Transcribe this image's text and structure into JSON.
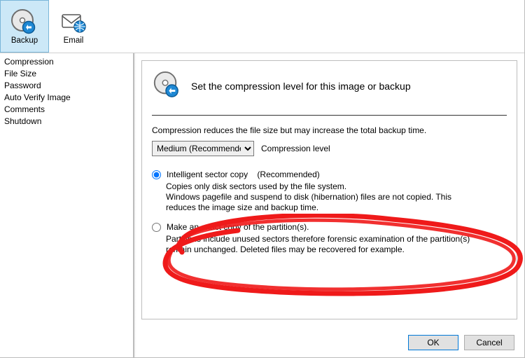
{
  "toolbar": {
    "backup_label": "Backup",
    "email_label": "Email"
  },
  "sidebar": {
    "items": [
      "Compression",
      "File Size",
      "Password",
      "Auto Verify Image",
      "Comments",
      "Shutdown"
    ]
  },
  "main": {
    "heading": "Set the compression level for this image or backup",
    "description": "Compression reduces the file size but may increase the total backup time.",
    "compression_select": {
      "value": "Medium (Recommended)",
      "label": "Compression level"
    },
    "options": [
      {
        "label": "Intelligent sector copy",
        "recommended": "(Recommended)",
        "description": "Copies only disk sectors used by the file system.\nWindows pagefile and suspend to disk (hibernation) files are not copied. This reduces the image size and backup time.",
        "checked": true
      },
      {
        "label": "Make an exact copy of the partition(s).",
        "recommended": "",
        "description": "Partitions include unused sectors therefore forensic examination of the partition(s) remain unchanged. Deleted files may be recovered for example.",
        "checked": false
      }
    ]
  },
  "buttons": {
    "ok": "OK",
    "cancel": "Cancel"
  }
}
